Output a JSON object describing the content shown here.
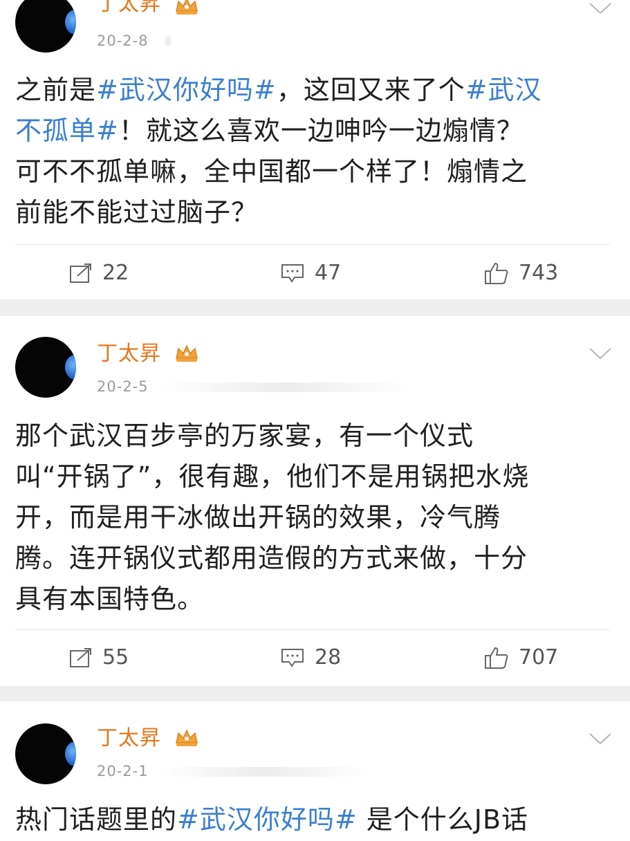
{
  "posts": [
    {
      "username": "丁太昇",
      "date": "20-2-8",
      "content": [
        {
          "text": "之前是",
          "tag": false
        },
        {
          "text": "#武汉你好吗#",
          "tag": true
        },
        {
          "text": "，这回又来了个",
          "tag": false
        },
        {
          "text": "#武汉不孤单#",
          "tag": true
        },
        {
          "text": "！就这么喜欢一边呻吟一边煽情？可不不孤单嘛，全中国都一个样了！煽情之前能不能过过脑子？",
          "tag": false
        }
      ],
      "lines": [
        [
          [
            "之前是",
            false
          ],
          [
            "#武汉你好吗#",
            true
          ],
          [
            "，这回又来了个",
            false
          ],
          [
            "#武汉",
            true
          ]
        ],
        [
          [
            "不孤单#",
            true
          ],
          [
            "！就这么喜欢一边呻吟一边煽情？",
            false
          ]
        ],
        [
          [
            "可不不孤单嘛，全中国都一个样了！煽情之",
            false
          ]
        ],
        [
          [
            "前能不能过过脑子？",
            false
          ]
        ]
      ],
      "reposts": "22",
      "comments": "47",
      "likes": "743"
    },
    {
      "username": "丁太昇",
      "date": "20-2-5",
      "lines": [
        [
          [
            "那个武汉百步亭的万家宴，有一个仪式",
            false
          ]
        ],
        [
          [
            "叫“开锅了”，很有趣，他们不是用锅把水烧",
            false
          ]
        ],
        [
          [
            "开，而是用干冰做出开锅的效果，冷气腾",
            false
          ]
        ],
        [
          [
            "腾。连开锅仪式都用造假的方式来做，十分",
            false
          ]
        ],
        [
          [
            "具有本国特色。",
            false
          ]
        ]
      ],
      "reposts": "55",
      "comments": "28",
      "likes": "707"
    },
    {
      "username": "丁太昇",
      "date": "20-2-1",
      "lines": [
        [
          [
            "热门话题里的",
            false
          ],
          [
            "#武汉你好吗#",
            true
          ],
          [
            " 是个什么JB话",
            false
          ]
        ]
      ]
    }
  ],
  "icons": {
    "repost": "repost-icon",
    "comment": "comment-icon",
    "like": "thumbs-up-icon",
    "more": "chevron-down-icon",
    "badge": "vip-crown-icon"
  },
  "colors": {
    "username": "#e8761c",
    "hashtag": "#3a7fd1",
    "separator": "#eeeeee"
  }
}
